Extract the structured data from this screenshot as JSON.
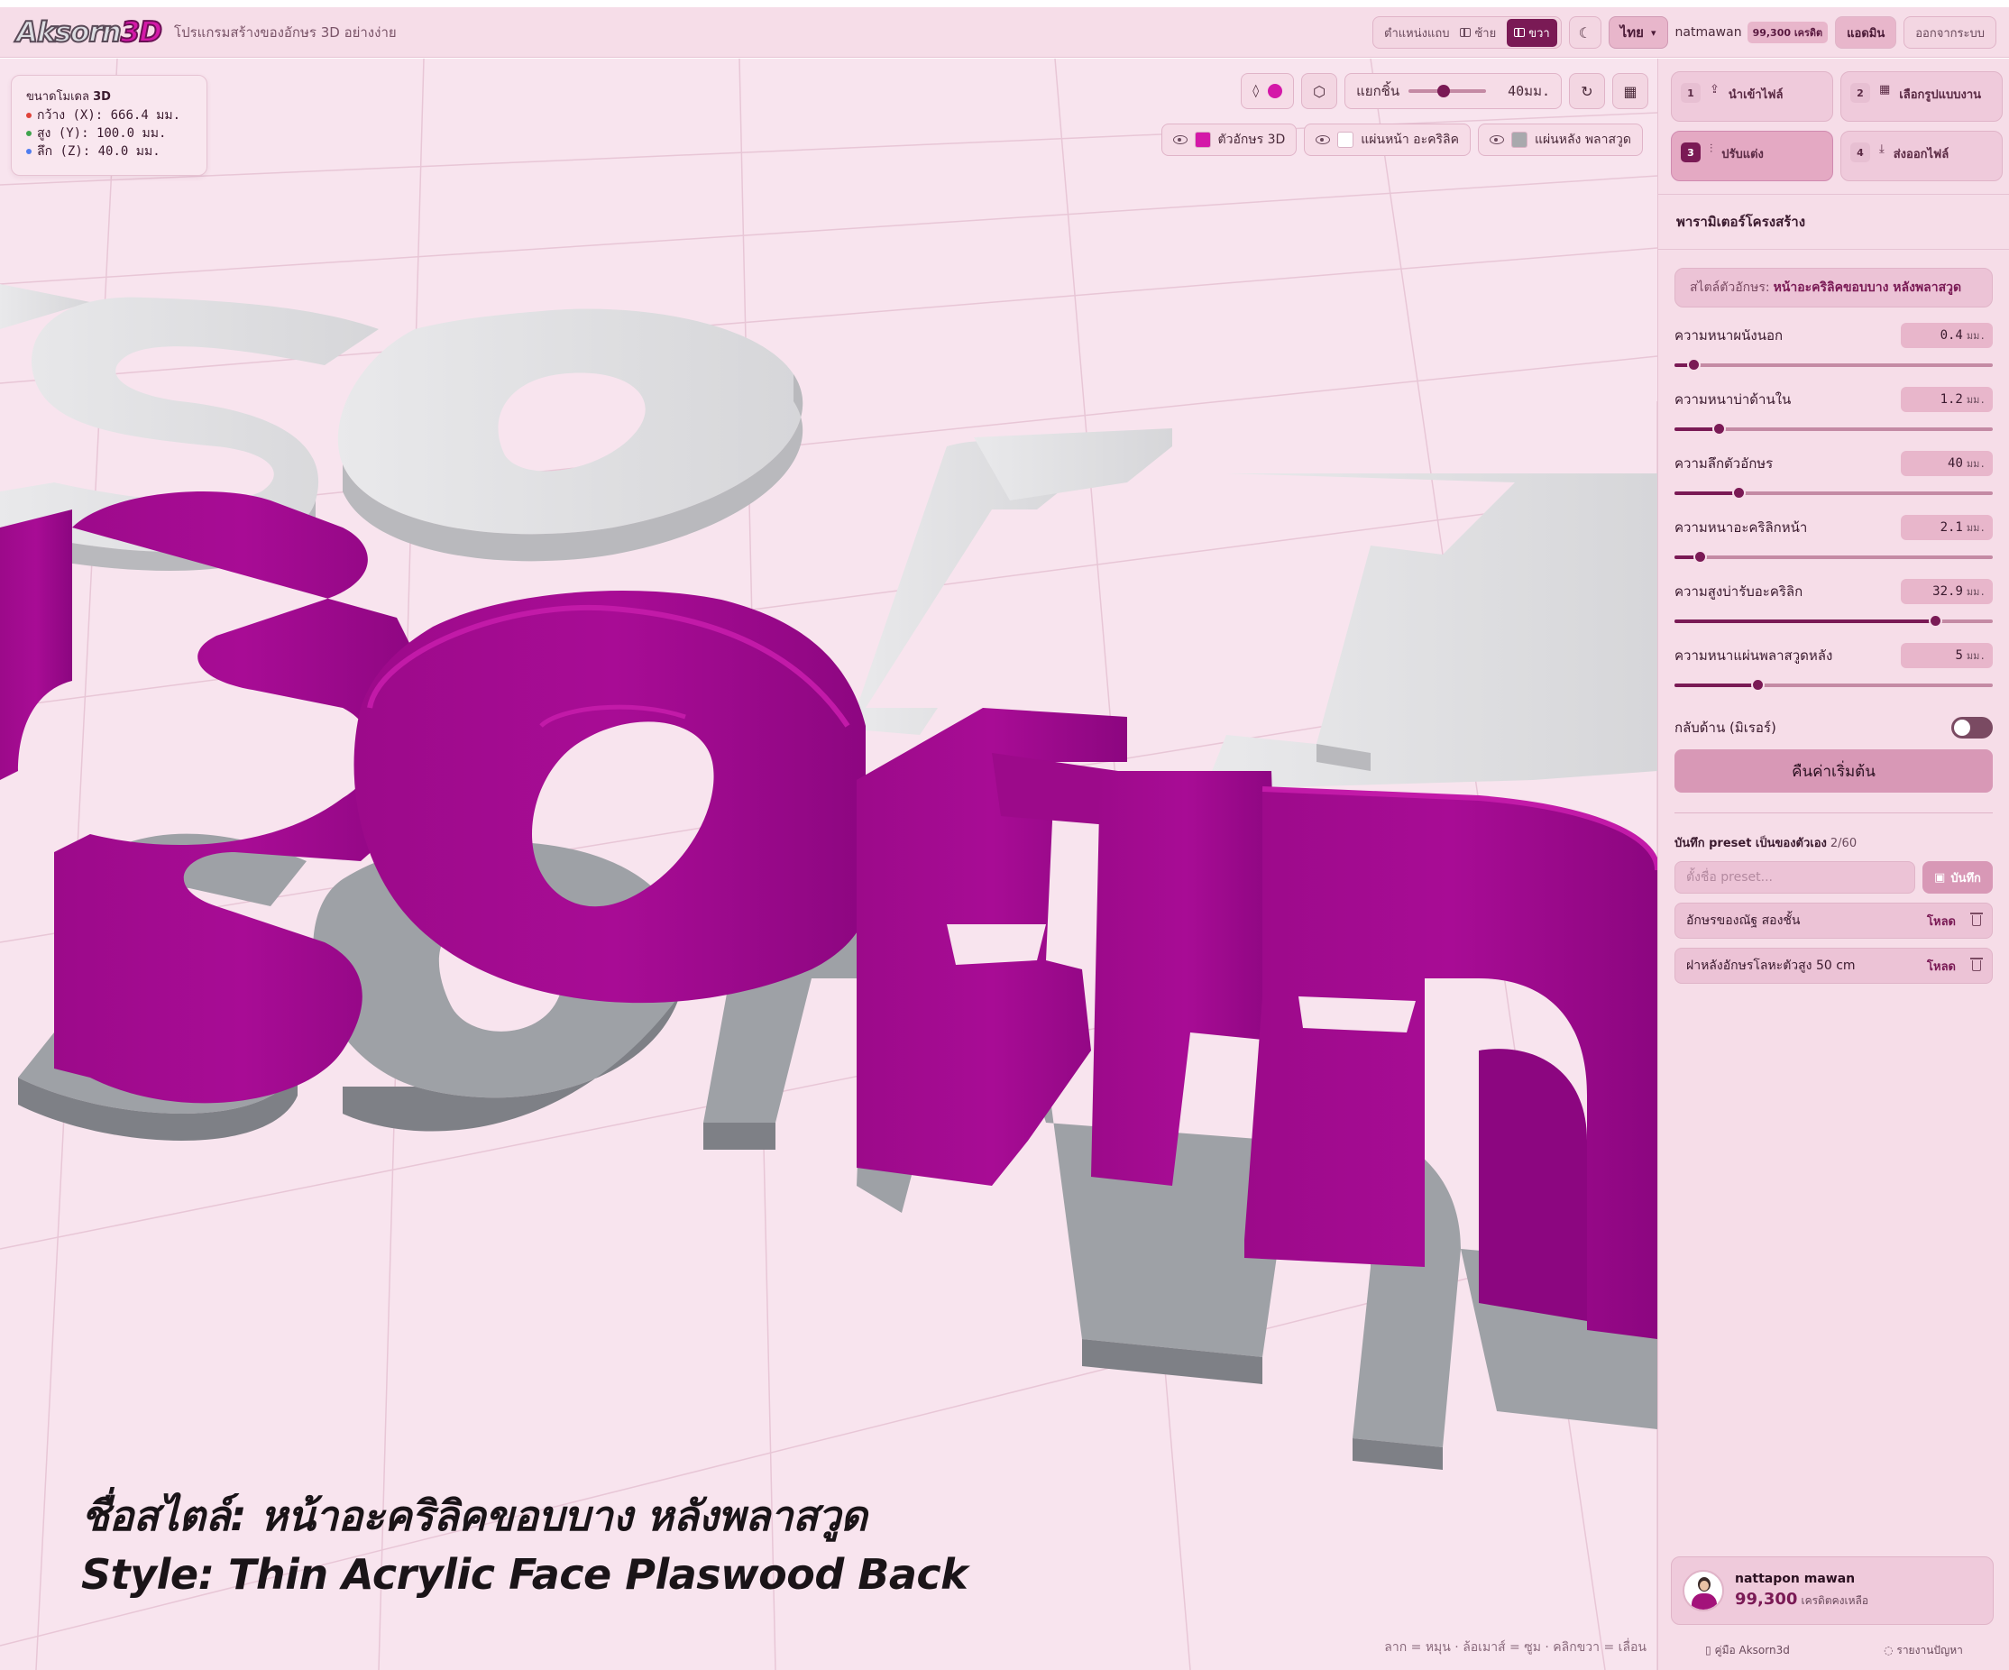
{
  "app": {
    "logo_main": "Aksorn",
    "logo_accent": "3D",
    "tagline": "โปรแกรมสร้างของอักษร 3D อย่างง่าย"
  },
  "topbar": {
    "layout_label": "ตำแหน่งแถบ",
    "layout_left": "ซ้าย",
    "layout_right": "ขวา",
    "theme_icon": "moon-icon",
    "language": "ไทย",
    "username": "natmawan",
    "credit_badge": "99,300 เครดิต",
    "admin_label": "แอดมิน",
    "logout_label": "ออกจากระบบ"
  },
  "model_dims": {
    "title_prefix": "ขนาดโมเดล",
    "title_bold": "3D",
    "width": "กว้าง (X): 666.4 มม.",
    "height": "สูง (Y): 100.0 มม.",
    "depth": "ลึก (Z): 40.0 มม.",
    "colors": {
      "x": "#e0433a",
      "y": "#3fa34d",
      "z": "#4f7df0"
    }
  },
  "view_tools": {
    "explode_label": "แยกชิ้น",
    "explode_value": "40มม.",
    "explode_fraction": 0.45,
    "accent_color": "#d418a8"
  },
  "visibility": [
    {
      "label": "ตัวอักษร 3D",
      "color": "#d418a8"
    },
    {
      "label": "แผ่นหน้า อะคริลิค",
      "color": "#ffffff"
    },
    {
      "label": "แผ่นหลัง พลาสวูด",
      "color": "#a8a9ad"
    }
  ],
  "caption": {
    "thai": "ชื่อสไตล์: หน้าอะคริลิคขอบบาง หลังพลาสวูด",
    "english": "Style: Thin Acrylic Face Plaswood Back"
  },
  "hint": "ลาก = หมุน · ล้อเมาส์ = ซูม · คลิกขวา = เลื่อน",
  "steps": [
    {
      "num": "1",
      "label": "นำเข้าไฟล์"
    },
    {
      "num": "2",
      "label": "เลือกรูปแบบงาน"
    },
    {
      "num": "3",
      "label": "ปรับแต่ง"
    },
    {
      "num": "4",
      "label": "ส่งออกไฟล์"
    }
  ],
  "params": {
    "title": "พารามิเตอร์โครงสร้าง",
    "style_prefix": "สไตล์ตัวอักษร:",
    "style_name": "หน้าอะคริลิคขอบบาง หลังพลาสวูด",
    "items": [
      {
        "label": "ความหนาผนังนอก",
        "value": "0.4",
        "unit": "มม.",
        "fraction": 0.06
      },
      {
        "label": "ความหนาบ่าด้านใน",
        "value": "1.2",
        "unit": "มม.",
        "fraction": 0.14
      },
      {
        "label": "ความลึกตัวอักษร",
        "value": "40",
        "unit": "มม.",
        "fraction": 0.2
      },
      {
        "label": "ความหนาอะคริลิกหน้า",
        "value": "2.1",
        "unit": "มม.",
        "fraction": 0.08
      },
      {
        "label": "ความสูงบ่ารับอะคริลิก",
        "value": "32.9",
        "unit": "มม.",
        "fraction": 0.82
      },
      {
        "label": "ความหนาแผ่นพลาสวูดหลัง",
        "value": "5",
        "unit": "มม.",
        "fraction": 0.26
      }
    ],
    "mirror_label": "กลับด้าน (มิเรอร์)",
    "reset_label": "คืนค่าเริ่มต้น"
  },
  "presets": {
    "title": "บันทึก preset เป็นของตัวเอง",
    "count": "2/60",
    "placeholder": "ตั้งชื่อ preset...",
    "save_label": "บันทึก",
    "load_label": "โหลด",
    "items": [
      {
        "name": "อักษรของณัฐ สองชั้น"
      },
      {
        "name": "ฝาหลังอักษรโลหะตัวสูง 50 cm"
      }
    ]
  },
  "profile": {
    "name": "nattapon mawan",
    "credits": "99,300",
    "credits_suffix": "เครดิตคงเหลือ"
  },
  "footer": {
    "guide": "คู่มือ Aksorn3d",
    "report": "รายงานปัญหา"
  }
}
